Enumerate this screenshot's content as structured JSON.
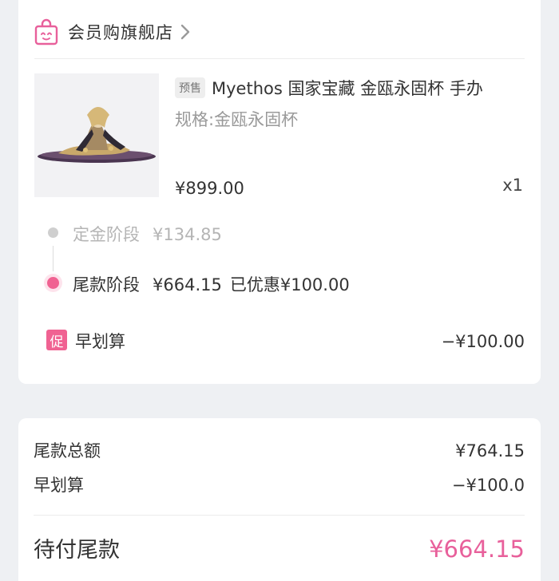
{
  "store": {
    "name": "会员购旗舰店",
    "icon": "shopping-bag-icon",
    "accent": "#e8609b"
  },
  "product": {
    "tag": "预售",
    "title": "Myethos 国家宝藏 金瓯永固杯 手办",
    "spec": "规格:金瓯永固杯",
    "price": "¥899.00",
    "quantity": "x1"
  },
  "stages": {
    "deposit": {
      "label": "定金阶段",
      "amount": "¥134.85"
    },
    "final": {
      "label": "尾款阶段",
      "amount": "¥664.15",
      "discount": "已优惠¥100.00"
    }
  },
  "promo": {
    "badge": "促",
    "label": "早划算",
    "amount": "−¥100.00"
  },
  "summary": {
    "total_label": "尾款总额",
    "total_value": "¥764.15",
    "early_label": "早划算",
    "early_value": "−¥100.0",
    "pay_label": "待付尾款",
    "pay_value": "¥664.15"
  }
}
